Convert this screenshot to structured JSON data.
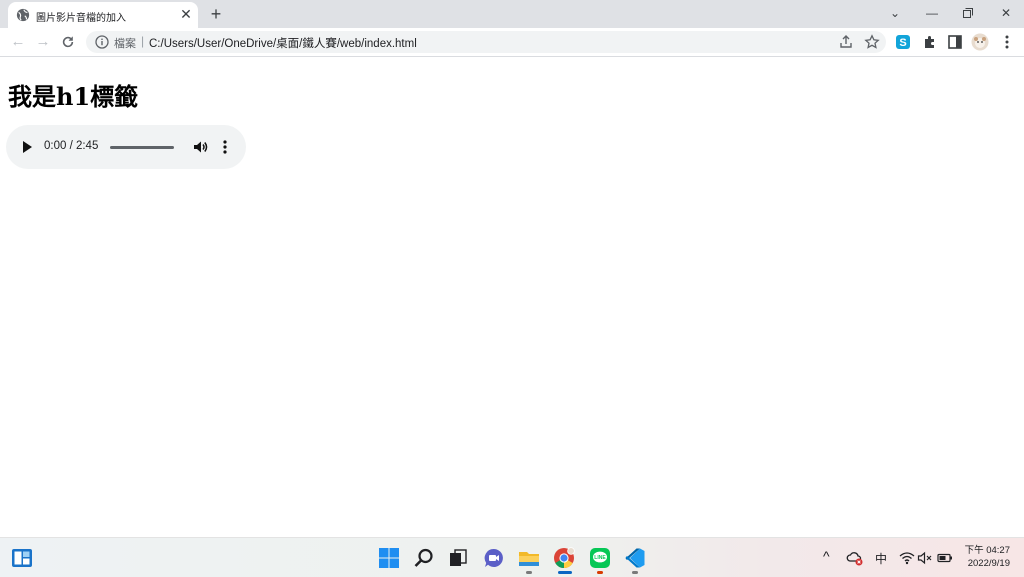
{
  "browser": {
    "tab": {
      "title": "圖片影片音檔的加入"
    },
    "address": {
      "scheme_label": "檔案",
      "url": "C:/Users/User/OneDrive/桌面/鐵人賽/web/index.html"
    }
  },
  "page": {
    "heading": "我是h1標籤",
    "audio": {
      "time": "0:00 / 2:45"
    }
  },
  "taskbar": {
    "ime": "中",
    "clock": {
      "period_time": "下午 04:27",
      "date": "2022/9/19"
    }
  },
  "icons": {
    "tab": [
      "globe-icon",
      "close-icon"
    ],
    "toolbar": [
      "back-icon",
      "forward-icon",
      "reload-icon",
      "info-icon",
      "share-icon",
      "star-icon",
      "extension-s-icon",
      "puzzle-icon",
      "sidepanel-icon",
      "profile-avatar-icon",
      "kebab-menu-icon"
    ],
    "taskbar": [
      "widgets-icon",
      "start-icon",
      "search-icon",
      "task-view-icon",
      "chat-icon",
      "file-explorer-icon",
      "chrome-icon",
      "line-icon",
      "vscode-icon"
    ]
  },
  "colors": {
    "tabstrip": "#dfe1e5",
    "omnibox": "#f1f3f4",
    "audio_bg": "#f1f3f4",
    "page_bg": "#ffffff"
  }
}
